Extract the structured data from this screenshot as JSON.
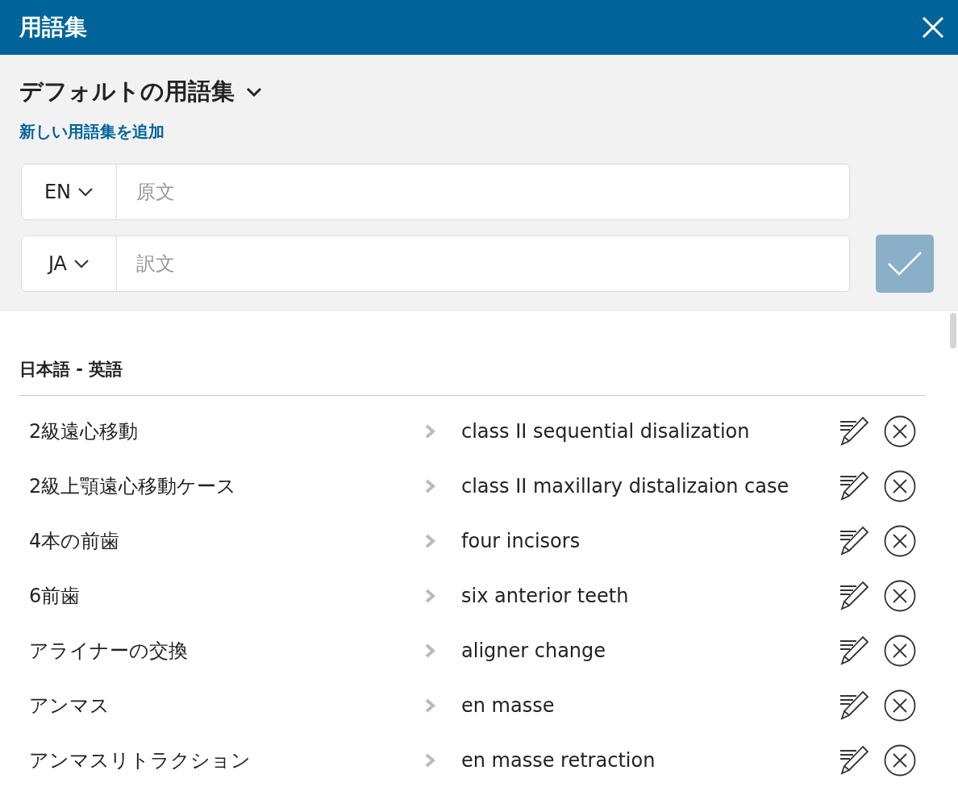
{
  "window": {
    "title": "用語集"
  },
  "glossary_selector": {
    "label": "デフォルトの用語集"
  },
  "add_glossary_link": "新しい用語集を追加",
  "source_field": {
    "language": "EN",
    "placeholder": "原文"
  },
  "target_field": {
    "language": "JA",
    "placeholder": "訳文"
  },
  "confirm_button": {
    "disabled": true
  },
  "list_heading": "日本語 - 英語",
  "entries": [
    {
      "source": "2級遠心移動",
      "target": "class II sequential disalization"
    },
    {
      "source": "2級上顎遠心移動ケース",
      "target": "class II maxillary distalizaion case"
    },
    {
      "source": "4本の前歯",
      "target": "four incisors"
    },
    {
      "source": "6前歯",
      "target": "six anterior teeth"
    },
    {
      "source": "アライナーの交換",
      "target": "aligner change"
    },
    {
      "source": "アンマス",
      "target": "en masse"
    },
    {
      "source": "アンマスリトラクション",
      "target": "en masse retraction"
    }
  ]
}
